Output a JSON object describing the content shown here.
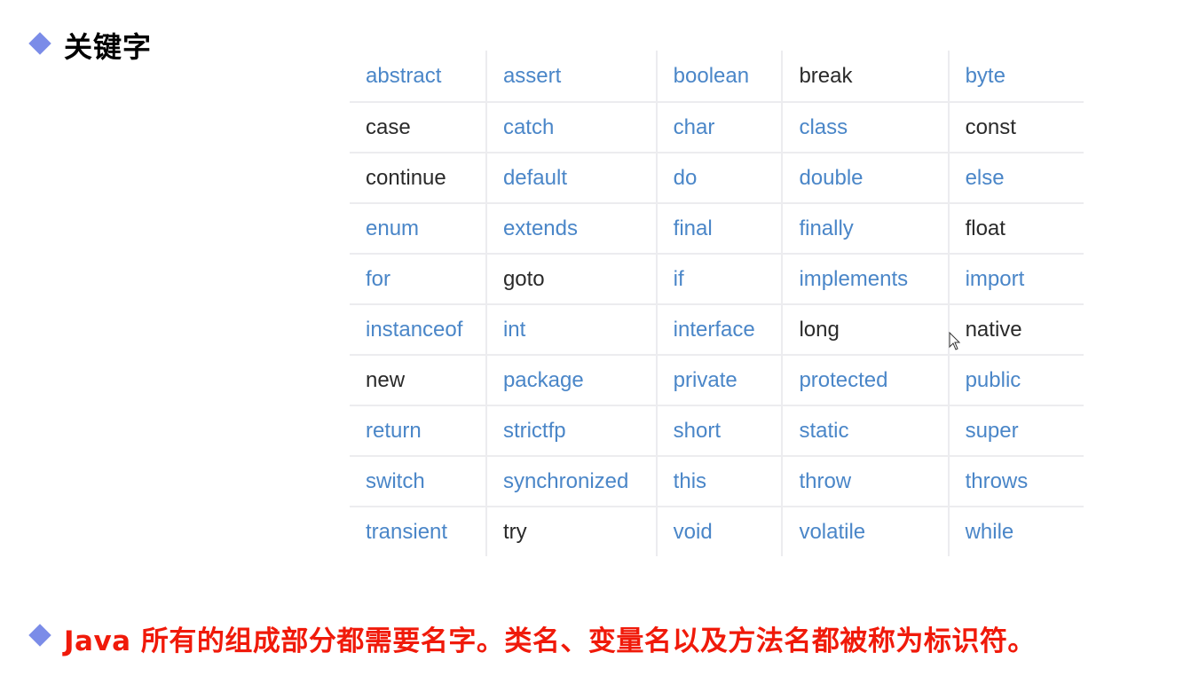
{
  "heading": {
    "bullet_icon": "diamond-icon",
    "title": "关键字"
  },
  "colors": {
    "bullet": "#7b8ce8",
    "keyword_link": "#4a86c8",
    "keyword_plain": "#2a2a2a",
    "footer_text": "#f01a0a"
  },
  "keywords_table": {
    "rows": [
      [
        {
          "text": "abstract",
          "style": "link"
        },
        {
          "text": "assert",
          "style": "link"
        },
        {
          "text": "boolean",
          "style": "link"
        },
        {
          "text": "break",
          "style": "plain"
        },
        {
          "text": "byte",
          "style": "link"
        }
      ],
      [
        {
          "text": "case",
          "style": "plain"
        },
        {
          "text": "catch",
          "style": "link"
        },
        {
          "text": "char",
          "style": "link"
        },
        {
          "text": "class",
          "style": "link"
        },
        {
          "text": "const",
          "style": "plain"
        }
      ],
      [
        {
          "text": "continue",
          "style": "plain"
        },
        {
          "text": "default",
          "style": "link"
        },
        {
          "text": "do",
          "style": "link"
        },
        {
          "text": "double",
          "style": "link"
        },
        {
          "text": "else",
          "style": "link"
        }
      ],
      [
        {
          "text": "enum",
          "style": "link"
        },
        {
          "text": "extends",
          "style": "link"
        },
        {
          "text": "final",
          "style": "link"
        },
        {
          "text": "finally",
          "style": "link"
        },
        {
          "text": "float",
          "style": "plain"
        }
      ],
      [
        {
          "text": "for",
          "style": "link"
        },
        {
          "text": "goto",
          "style": "plain"
        },
        {
          "text": "if",
          "style": "link"
        },
        {
          "text": "implements",
          "style": "link"
        },
        {
          "text": "import",
          "style": "link"
        }
      ],
      [
        {
          "text": "instanceof",
          "style": "link"
        },
        {
          "text": "int",
          "style": "link"
        },
        {
          "text": "interface",
          "style": "link"
        },
        {
          "text": "long",
          "style": "plain"
        },
        {
          "text": "native",
          "style": "plain"
        }
      ],
      [
        {
          "text": "new",
          "style": "plain"
        },
        {
          "text": "package",
          "style": "link"
        },
        {
          "text": "private",
          "style": "link"
        },
        {
          "text": "protected",
          "style": "link"
        },
        {
          "text": "public",
          "style": "link"
        }
      ],
      [
        {
          "text": "return",
          "style": "link"
        },
        {
          "text": "strictfp",
          "style": "link"
        },
        {
          "text": "short",
          "style": "link"
        },
        {
          "text": "static",
          "style": "link"
        },
        {
          "text": "super",
          "style": "link"
        }
      ],
      [
        {
          "text": "switch",
          "style": "link"
        },
        {
          "text": "synchronized",
          "style": "link"
        },
        {
          "text": "this",
          "style": "link"
        },
        {
          "text": "throw",
          "style": "link"
        },
        {
          "text": "throws",
          "style": "link"
        }
      ],
      [
        {
          "text": "transient",
          "style": "link"
        },
        {
          "text": "try",
          "style": "plain"
        },
        {
          "text": "void",
          "style": "link"
        },
        {
          "text": "volatile",
          "style": "link"
        },
        {
          "text": "while",
          "style": "link"
        }
      ]
    ]
  },
  "footer": {
    "bullet_icon": "diamond-icon",
    "text": "Java 所有的组成部分都需要名字。类名、变量名以及方法名都被称为标识符。"
  },
  "cursor_icon": "mouse-pointer-icon"
}
